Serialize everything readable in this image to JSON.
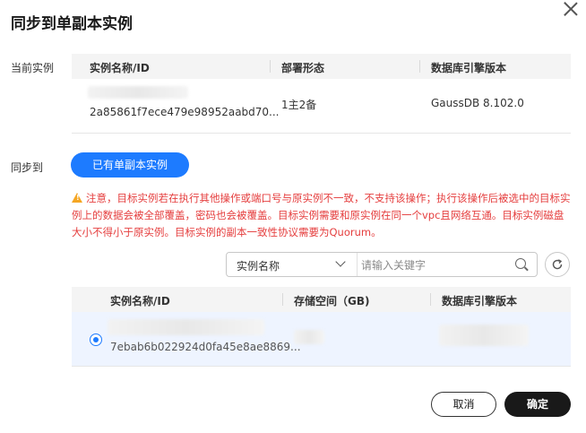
{
  "dialog": {
    "title": "同步到单副本实例",
    "close_icon": "close-icon"
  },
  "current": {
    "label": "当前实例",
    "columns": [
      "实例名称/ID",
      "部署形态",
      "数据库引擎版本"
    ],
    "row": {
      "id": "2a85861f7ece479e98952aabd70...",
      "deployment": "1主2备",
      "engine": "GaussDB 8.102.0"
    }
  },
  "sync": {
    "label": "同步到",
    "button": "已有单副本实例"
  },
  "warning": {
    "icon": "warning-icon",
    "text": "注意，目标实例若在执行其他操作或端口号与原实例不一致，不支持该操作；执行该操作后被选中的目标实例上的数据会被全部覆盖，密码也会被覆盖。目标实例需要和原实例在同一个vpc且网络互通。目标实例磁盘大小不得小于原实例。目标实例的副本一致性协议需要为Quorum。"
  },
  "search": {
    "filter_selected": "实例名称",
    "placeholder": "请输入关键字"
  },
  "target": {
    "columns": [
      "实例名称/ID",
      "存储空间（GB)",
      "数据库引擎版本"
    ],
    "row": {
      "id": "7ebab6b022924d0fa45e8ae8869..."
    }
  },
  "footer": {
    "cancel": "取消",
    "ok": "确定"
  },
  "colors": {
    "primary": "#1d7bff",
    "warning": "#e53e3e",
    "selected_row": "#eef4ff"
  }
}
